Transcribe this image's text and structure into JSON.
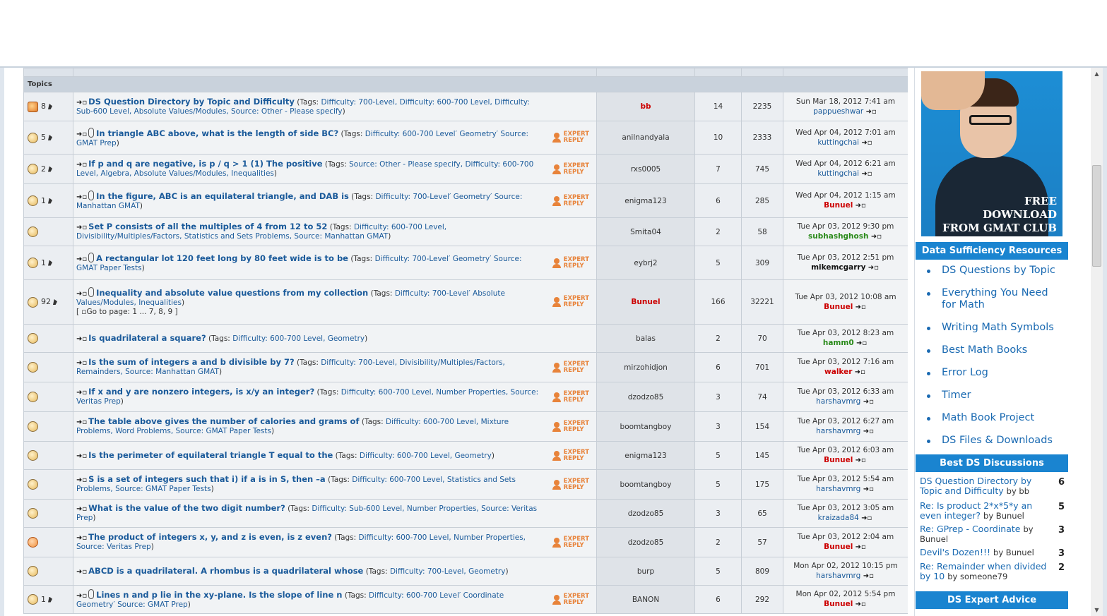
{
  "table": {
    "header_label": "Topics",
    "expert_line1": "EXPERT",
    "expert_line2": "REPLY",
    "newpost_glyph": "➜▫",
    "rows": [
      {
        "icon": "hot",
        "count": "8",
        "attach": false,
        "expert": false,
        "title": "DS Question Directory by Topic and Difficulty",
        "tags_prefix": "(Tags:",
        "tags": [
          "Difficulty: 700-Level,",
          "Difficulty: 600-700 Level,",
          "Difficulty: Sub-600 Level,",
          "Absolute Values/Modules,",
          "Source: Other - Please specify"
        ],
        "tags_suffix": ")",
        "author": "bb",
        "author_style": "red",
        "replies": "14",
        "views": "2235",
        "last_date": "Sun Mar 18, 2012 7:41 am",
        "last_user": "pappueshwar",
        "last_style": "",
        "goto": ""
      },
      {
        "icon": "normal",
        "count": "5",
        "attach": true,
        "expert": true,
        "title": "In triangle ABC above, what is the length of side BC?",
        "tags_prefix": "(Tags:",
        "tags": [
          "Difficulty: 600-700 Level′",
          "Geometry′",
          "Source:",
          "GMAT Prep"
        ],
        "tags_suffix": ")",
        "author": "anilnandyala",
        "author_style": "",
        "replies": "10",
        "views": "2333",
        "last_date": "Wed Apr 04, 2012 7:01 am",
        "last_user": "kuttingchai",
        "last_style": "",
        "goto": ""
      },
      {
        "icon": "normal",
        "count": "2",
        "attach": false,
        "expert": true,
        "title": "If p and q are negative, is p / q > 1 (1) The positive",
        "tags_prefix": "(Tags:",
        "tags": [
          "Source: Other - Please specify,",
          "Difficulty: 600-700",
          "Level,",
          "Algebra,",
          "Absolute Values/Modules,",
          "Inequalities"
        ],
        "tags_suffix": ")",
        "author": "rxs0005",
        "author_style": "",
        "replies": "7",
        "views": "745",
        "last_date": "Wed Apr 04, 2012 6:21 am",
        "last_user": "kuttingchai",
        "last_style": "",
        "goto": ""
      },
      {
        "icon": "normal",
        "count": "1",
        "attach": true,
        "expert": true,
        "title": "In the figure, ABC is an equilateral triangle, and DAB is",
        "tags_prefix": "(Tags:",
        "tags": [
          "Difficulty: 700-Level′",
          "Geometry′",
          "Source:",
          "Manhattan GMAT"
        ],
        "tags_suffix": ")",
        "author": "enigma123",
        "author_style": "",
        "replies": "6",
        "views": "285",
        "last_date": "Wed Apr 04, 2012 1:15 am",
        "last_user": "Bunuel",
        "last_style": "red",
        "goto": ""
      },
      {
        "icon": "normal",
        "count": "",
        "attach": false,
        "expert": false,
        "title": "Set P consists of all the multiples of 4 from 12 to 52",
        "tags_prefix": "(Tags:",
        "tags": [
          "Difficulty: 600-700 Level,",
          "Divisibility/Multiples/Factors,",
          "Statistics",
          "and Sets Problems,",
          "Source: Manhattan GMAT"
        ],
        "tags_suffix": ")",
        "author": "Smita04",
        "author_style": "",
        "replies": "2",
        "views": "58",
        "last_date": "Tue Apr 03, 2012 9:30 pm",
        "last_user": "subhashghosh",
        "last_style": "green",
        "goto": ""
      },
      {
        "icon": "normal",
        "count": "1",
        "attach": true,
        "expert": true,
        "title": "A rectangular lot 120 feet long by 80 feet wide is to be",
        "tags_prefix": "(Tags:",
        "tags": [
          "Difficulty: 700-Level′",
          "Geometry′",
          "Source: GMAT",
          "Paper Tests"
        ],
        "tags_suffix": ")",
        "author": "eybrj2",
        "author_style": "",
        "replies": "5",
        "views": "309",
        "last_date": "Tue Apr 03, 2012 2:51 pm",
        "last_user": "mikemcgarry",
        "last_style": "black",
        "goto": ""
      },
      {
        "icon": "normal",
        "count": "92",
        "attach": true,
        "expert": true,
        "title": "Inequality and absolute value questions from my collection",
        "tags_prefix": "(Tags:",
        "tags": [
          "Difficulty: 700-Level′",
          "Absolute",
          "Values/Modules,",
          "Inequalities"
        ],
        "tags_suffix": ")",
        "author": "Bunuel",
        "author_style": "red",
        "replies": "166",
        "views": "32221",
        "last_date": "Tue Apr 03, 2012 10:08 am",
        "last_user": "Bunuel",
        "last_style": "red",
        "goto": "[ ▫Go to page: 1 ... 7, 8, 9 ]"
      },
      {
        "icon": "normal",
        "count": "",
        "attach": false,
        "expert": false,
        "title": "Is quadrilateral a square?",
        "tags_prefix": "(Tags:",
        "tags": [
          "Difficulty: 600-700 Level,",
          "Geometry"
        ],
        "tags_suffix": ")",
        "author": "balas",
        "author_style": "",
        "replies": "2",
        "views": "70",
        "last_date": "Tue Apr 03, 2012 8:23 am",
        "last_user": "hamm0",
        "last_style": "green",
        "goto": ""
      },
      {
        "icon": "normal",
        "count": "",
        "attach": false,
        "expert": true,
        "title": "Is the sum of integers a and b divisible by 7?",
        "tags_prefix": "(Tags:",
        "tags": [
          "Difficulty: 700-Level,",
          "Divisibility/Multiples/Factors,",
          "Remainders,",
          "Source: Manhattan GMAT"
        ],
        "tags_suffix": ")",
        "author": "mirzohidjon",
        "author_style": "",
        "replies": "6",
        "views": "701",
        "last_date": "Tue Apr 03, 2012 7:16 am",
        "last_user": "walker",
        "last_style": "red",
        "goto": ""
      },
      {
        "icon": "normal",
        "count": "",
        "attach": false,
        "expert": true,
        "title": "If x and y are nonzero integers, is x/y an integer?",
        "tags_prefix": "(Tags:",
        "tags": [
          "Difficulty: 600-700 Level,",
          "Number Properties,",
          "Source:",
          "Veritas Prep"
        ],
        "tags_suffix": ")",
        "author": "dzodzo85",
        "author_style": "",
        "replies": "3",
        "views": "74",
        "last_date": "Tue Apr 03, 2012 6:33 am",
        "last_user": "harshavmrg",
        "last_style": "",
        "goto": ""
      },
      {
        "icon": "normal",
        "count": "",
        "attach": false,
        "expert": true,
        "title": "The table above gives the number of calories and grams of",
        "tags_prefix": "(Tags:",
        "tags": [
          "Difficulty: 600-700 Level,",
          "Mixture Problems,",
          "Word Problems,",
          "Source: GMAT Paper Tests"
        ],
        "tags_suffix": ")",
        "author": "boomtangboy",
        "author_style": "",
        "replies": "3",
        "views": "154",
        "last_date": "Tue Apr 03, 2012 6:27 am",
        "last_user": "harshavmrg",
        "last_style": "",
        "goto": ""
      },
      {
        "icon": "normal",
        "count": "",
        "attach": false,
        "expert": true,
        "title": "Is the perimeter of equilateral triangle T equal to the",
        "tags_prefix": "(Tags:",
        "tags": [
          "Difficulty: 600-700 Level,",
          "Geometry"
        ],
        "tags_suffix": ")",
        "author": "enigma123",
        "author_style": "",
        "replies": "5",
        "views": "145",
        "last_date": "Tue Apr 03, 2012 6:03 am",
        "last_user": "Bunuel",
        "last_style": "red",
        "goto": ""
      },
      {
        "icon": "normal",
        "count": "",
        "attach": false,
        "expert": true,
        "title": "S is a set of integers such that i) if a is in S, then –a",
        "tags_prefix": "(Tags:",
        "tags": [
          "Difficulty: 600-700 Level,",
          "Statistics and Sets",
          "Problems,",
          "Source: GMAT Paper Tests"
        ],
        "tags_suffix": ")",
        "author": "boomtangboy",
        "author_style": "",
        "replies": "5",
        "views": "175",
        "last_date": "Tue Apr 03, 2012 5:54 am",
        "last_user": "harshavmrg",
        "last_style": "",
        "goto": ""
      },
      {
        "icon": "normal",
        "count": "",
        "attach": false,
        "expert": false,
        "title": "What is the value of the two digit number?",
        "tags_prefix": "(Tags:",
        "tags": [
          "Difficulty: Sub-600 Level,",
          "Number Properties,",
          "Source: Veritas Prep"
        ],
        "tags_suffix": ")",
        "author": "dzodzo85",
        "author_style": "",
        "replies": "3",
        "views": "65",
        "last_date": "Tue Apr 03, 2012 3:05 am",
        "last_user": "kraizada84",
        "last_style": "",
        "goto": ""
      },
      {
        "icon": "lock",
        "count": "",
        "attach": false,
        "expert": true,
        "title": "The product of integers x, y, and z is even, is z even?",
        "tags_prefix": "(Tags:",
        "tags": [
          "Difficulty: 600-700 Level,",
          "Number Properties,",
          "Source: Veritas Prep"
        ],
        "tags_suffix": ")",
        "author": "dzodzo85",
        "author_style": "",
        "replies": "2",
        "views": "57",
        "last_date": "Tue Apr 03, 2012 2:04 am",
        "last_user": "Bunuel",
        "last_style": "red",
        "goto": ""
      },
      {
        "icon": "normal",
        "count": "",
        "attach": false,
        "expert": false,
        "title": "ABCD is a quadrilateral. A rhombus is a quadrilateral whose",
        "tags_prefix": "(Tags:",
        "tags": [
          "Difficulty: 700-Level,",
          "Geometry"
        ],
        "tags_suffix": ")",
        "author": "burp",
        "author_style": "",
        "replies": "5",
        "views": "809",
        "last_date": "Mon Apr 02, 2012 10:15 pm",
        "last_user": "harshavmrg",
        "last_style": "",
        "goto": ""
      },
      {
        "icon": "normal",
        "count": "1",
        "attach": true,
        "expert": true,
        "title": "Lines n and p lie in the xy-plane. Is the slope of line n",
        "tags_prefix": "(Tags:",
        "tags": [
          "Difficulty: 600-700 Level′",
          "Coordinate Geometry′",
          "Source: GMAT Prep"
        ],
        "tags_suffix": ")",
        "author": "BANON",
        "author_style": "",
        "replies": "6",
        "views": "292",
        "last_date": "Mon Apr 02, 2012 5:54 pm",
        "last_user": "Bunuel",
        "last_style": "red",
        "goto": ""
      }
    ]
  },
  "sidebar": {
    "ad_line1": "FREE",
    "ad_line2": "DOWNLOAD",
    "ad_line3": "FROM GMAT CLUB",
    "resources_title": "Data Sufficiency Resources",
    "resources": [
      "DS Questions by Topic",
      "Everything You Need for Math",
      "Writing Math Symbols",
      "Best Math Books",
      "Error Log",
      "Timer",
      "Math Book Project",
      "DS Files & Downloads"
    ],
    "discussions_title": "Best DS Discussions",
    "discussions": [
      {
        "title": "DS Question Directory by Topic and Difficulty",
        "by": "by bb",
        "count": "6"
      },
      {
        "title": "Re: Is product 2*x*5*y an even integer?",
        "by": "by Bunuel",
        "count": "5"
      },
      {
        "title": "Re: GPrep - Coordinate",
        "by": "by Bunuel",
        "count": "3"
      },
      {
        "title": "Devil's Dozen!!!",
        "by": "by Bunuel",
        "count": "3"
      },
      {
        "title": "Re: Remainder when divided by 10",
        "by": "by someone79",
        "count": "2"
      }
    ],
    "expert_title": "DS Expert Advice"
  },
  "scrollbar": {
    "up": "▲",
    "down": "▼"
  }
}
